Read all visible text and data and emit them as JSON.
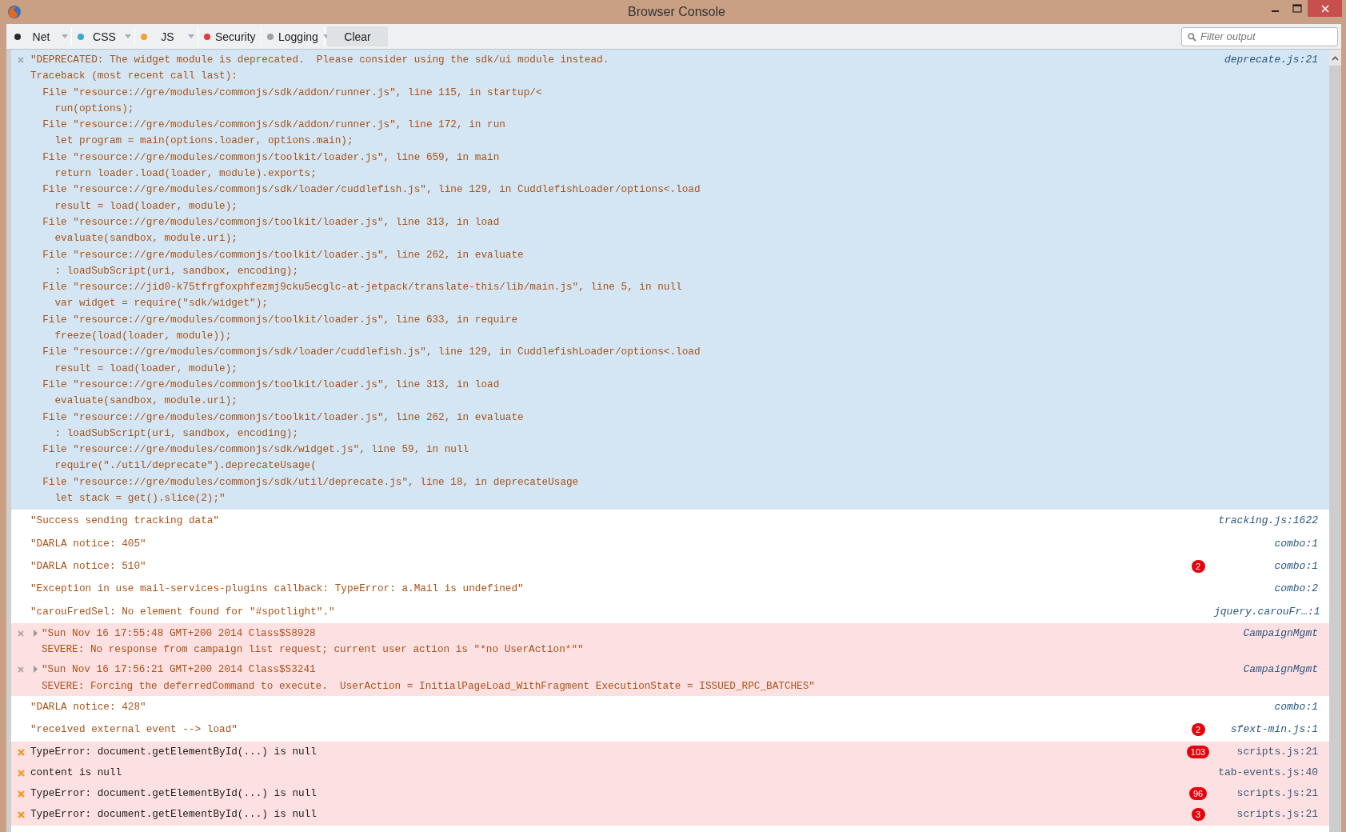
{
  "window": {
    "title": "Browser Console"
  },
  "toolbar": {
    "filters": [
      {
        "label": "Net",
        "color": "#2b2b2b"
      },
      {
        "label": "CSS",
        "color": "#3ea6d8"
      },
      {
        "label": "JS",
        "color": "#f0a235"
      },
      {
        "label": "Security",
        "color": "#e23b3b"
      },
      {
        "label": "Logging",
        "color": "#a0a0a0"
      }
    ],
    "clear_button": "Clear",
    "filter_field": {
      "placeholder": "Filter output"
    }
  },
  "messages": [
    {
      "kind": "deprecation",
      "text": "\"DEPRECATED: The widget module is deprecated.  Please consider using the sdk/ui module instead.\nTraceback (most recent call last):\n  File \"resource://gre/modules/commonjs/sdk/addon/runner.js\", line 115, in startup/<\n    run(options);\n  File \"resource://gre/modules/commonjs/sdk/addon/runner.js\", line 172, in run\n    let program = main(options.loader, options.main);\n  File \"resource://gre/modules/commonjs/toolkit/loader.js\", line 659, in main\n    return loader.load(loader, module).exports;\n  File \"resource://gre/modules/commonjs/sdk/loader/cuddlefish.js\", line 129, in CuddlefishLoader/options<.load\n    result = load(loader, module);\n  File \"resource://gre/modules/commonjs/toolkit/loader.js\", line 313, in load\n    evaluate(sandbox, module.uri);\n  File \"resource://gre/modules/commonjs/toolkit/loader.js\", line 262, in evaluate\n    : loadSubScript(uri, sandbox, encoding);\n  File \"resource://jid0-k75tfrgfoxphfezmj9cku5ecglc-at-jetpack/translate-this/lib/main.js\", line 5, in null\n    var widget = require(\"sdk/widget\");\n  File \"resource://gre/modules/commonjs/toolkit/loader.js\", line 633, in require\n    freeze(load(loader, module));\n  File \"resource://gre/modules/commonjs/sdk/loader/cuddlefish.js\", line 129, in CuddlefishLoader/options<.load\n    result = load(loader, module);\n  File \"resource://gre/modules/commonjs/toolkit/loader.js\", line 313, in load\n    evaluate(sandbox, module.uri);\n  File \"resource://gre/modules/commonjs/toolkit/loader.js\", line 262, in evaluate\n    : loadSubScript(uri, sandbox, encoding);\n  File \"resource://gre/modules/commonjs/sdk/widget.js\", line 59, in null\n    require(\"./util/deprecate\").deprecateUsage(\n  File \"resource://gre/modules/commonjs/sdk/util/deprecate.js\", line 18, in deprecateUsage\n    let stack = get().slice(2);\"",
      "source": "deprecate.js:21"
    },
    {
      "kind": "log",
      "text": "\"Success sending tracking data\"",
      "source": "tracking.js:1622"
    },
    {
      "kind": "log",
      "text": "\"DARLA notice: 405\"",
      "source": "combo:1"
    },
    {
      "kind": "log",
      "text": "\"DARLA notice: 510\"",
      "count": "2",
      "source": "combo:1"
    },
    {
      "kind": "log",
      "text": "\"Exception in use mail-services-plugins callback: TypeError: a.Mail is undefined\"",
      "source": "combo:2"
    },
    {
      "kind": "log",
      "text": "\"carouFredSel: No element found for \"#spotlight\".\"",
      "source": "jquery.carouFr…:1"
    },
    {
      "kind": "group",
      "expanded": false,
      "text": "\"Sun Nov 16 17:55:48 GMT+200 2014 Class$S8928\nSEVERE: No response from campaign list request; current user action is \"*no UserAction*\"\"",
      "source": "CampaignMgmt"
    },
    {
      "kind": "group",
      "expanded": false,
      "text": "\"Sun Nov 16 17:56:21 GMT+200 2014 Class$S3241\nSEVERE: Forcing the deferredCommand to execute.  UserAction = InitialPageLoad_WithFragment ExecutionState = ISSUED_RPC_BATCHES\"",
      "source": "CampaignMgmt"
    },
    {
      "kind": "log",
      "text": "\"DARLA notice: 428\"",
      "source": "combo:1"
    },
    {
      "kind": "log",
      "text": "\"received external event --> load\"",
      "count": "2",
      "source": "sfext-min.js:1"
    },
    {
      "kind": "error",
      "text": "TypeError: document.getElementById(...) is null",
      "count": "103",
      "source": "scripts.js:21"
    },
    {
      "kind": "error",
      "text": "content is null",
      "source": "tab-events.js:40"
    },
    {
      "kind": "error",
      "text": "TypeError: document.getElementById(...) is null",
      "count": "96",
      "source": "scripts.js:21"
    },
    {
      "kind": "error",
      "text": "TypeError: document.getElementById(...) is null",
      "count": "3",
      "source": "scripts.js:21"
    }
  ]
}
